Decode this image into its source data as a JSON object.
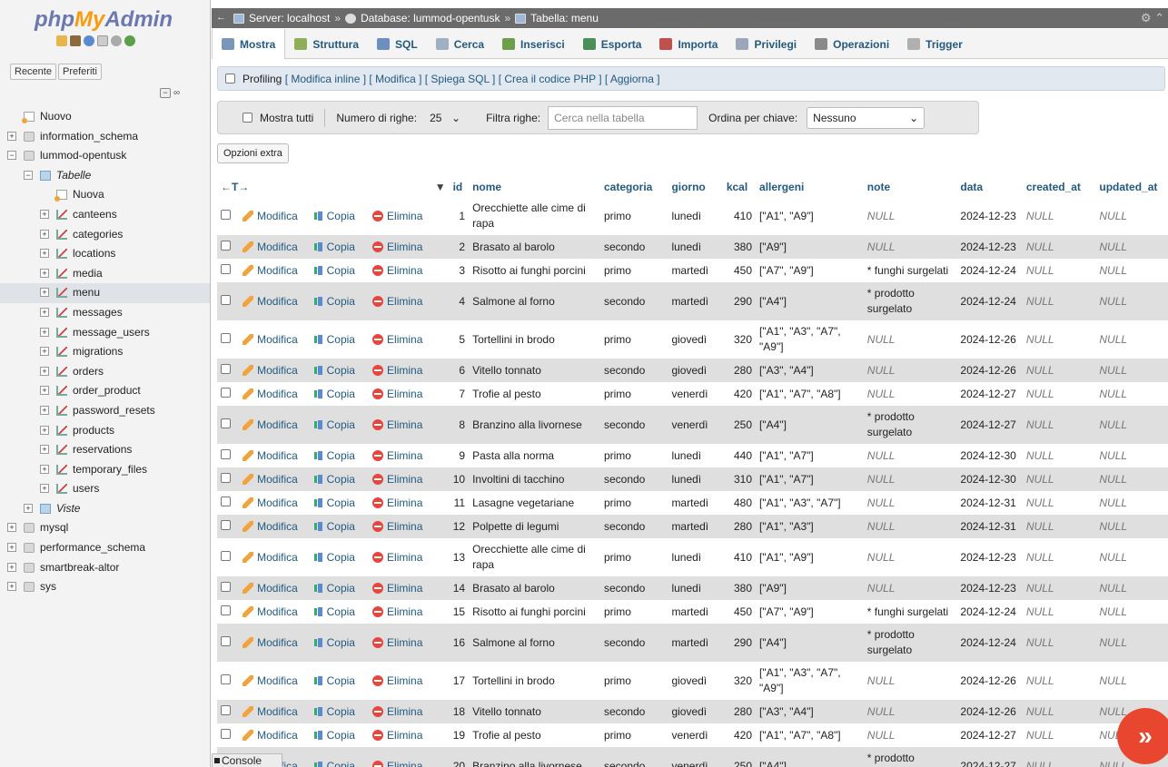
{
  "sidebar": {
    "logo_php": "php",
    "logo_my": "My",
    "logo_admin": "Admin",
    "recent": "Recente",
    "favorites": "Preferiti",
    "tree": [
      {
        "label": "Nuovo",
        "indent": 0,
        "icon": "new-icon",
        "exp": ""
      },
      {
        "label": "information_schema",
        "indent": 0,
        "icon": "database-icon",
        "exp": "+"
      },
      {
        "label": "lummod-opentusk",
        "indent": 0,
        "icon": "database-icon",
        "exp": "−"
      },
      {
        "label": "Tabelle",
        "indent": 1,
        "icon": "folder-icon",
        "exp": "−",
        "italic": true
      },
      {
        "label": "Nuova",
        "indent": 2,
        "icon": "new-icon",
        "exp": ""
      },
      {
        "label": "canteens",
        "indent": 2,
        "icon": "table-icon",
        "exp": "+"
      },
      {
        "label": "categories",
        "indent": 2,
        "icon": "table-icon",
        "exp": "+"
      },
      {
        "label": "locations",
        "indent": 2,
        "icon": "table-icon",
        "exp": "+"
      },
      {
        "label": "media",
        "indent": 2,
        "icon": "table-icon",
        "exp": "+"
      },
      {
        "label": "menu",
        "indent": 2,
        "icon": "table-icon",
        "exp": "+",
        "selected": true
      },
      {
        "label": "messages",
        "indent": 2,
        "icon": "table-icon",
        "exp": "+"
      },
      {
        "label": "message_users",
        "indent": 2,
        "icon": "table-icon",
        "exp": "+"
      },
      {
        "label": "migrations",
        "indent": 2,
        "icon": "table-icon",
        "exp": "+"
      },
      {
        "label": "orders",
        "indent": 2,
        "icon": "table-icon",
        "exp": "+"
      },
      {
        "label": "order_product",
        "indent": 2,
        "icon": "table-icon",
        "exp": "+"
      },
      {
        "label": "password_resets",
        "indent": 2,
        "icon": "table-icon",
        "exp": "+"
      },
      {
        "label": "products",
        "indent": 2,
        "icon": "table-icon",
        "exp": "+"
      },
      {
        "label": "reservations",
        "indent": 2,
        "icon": "table-icon",
        "exp": "+"
      },
      {
        "label": "temporary_files",
        "indent": 2,
        "icon": "table-icon",
        "exp": "+"
      },
      {
        "label": "users",
        "indent": 2,
        "icon": "table-icon",
        "exp": "+"
      },
      {
        "label": "Viste",
        "indent": 1,
        "icon": "folder-icon",
        "exp": "+",
        "italic": true
      },
      {
        "label": "mysql",
        "indent": 0,
        "icon": "database-icon",
        "exp": "+"
      },
      {
        "label": "performance_schema",
        "indent": 0,
        "icon": "database-icon",
        "exp": "+"
      },
      {
        "label": "smartbreak-altor",
        "indent": 0,
        "icon": "database-icon",
        "exp": "+"
      },
      {
        "label": "sys",
        "indent": 0,
        "icon": "database-icon",
        "exp": "+"
      }
    ]
  },
  "breadcrumb": {
    "server": "Server: localhost",
    "database": "Database: lummod-opentusk",
    "table": "Tabella: menu",
    "sep": "»"
  },
  "tabs": [
    {
      "label": "Mostra",
      "color": "#7a96b8"
    },
    {
      "label": "Struttura",
      "color": "#8fae5a"
    },
    {
      "label": "SQL",
      "color": "#6c8fbf"
    },
    {
      "label": "Cerca",
      "color": "#9fb0c0"
    },
    {
      "label": "Inserisci",
      "color": "#6d9f4a"
    },
    {
      "label": "Esporta",
      "color": "#4a8f5a"
    },
    {
      "label": "Importa",
      "color": "#c0504d"
    },
    {
      "label": "Privilegi",
      "color": "#9aa7b8"
    },
    {
      "label": "Operazioni",
      "color": "#8a8a8a"
    },
    {
      "label": "Trigger",
      "color": "#b0b0b0"
    }
  ],
  "profiling": {
    "label": "Profiling",
    "links": "[ Modifica inline ] [ Modifica ] [ Spiega SQL ] [ Crea il codice PHP ] [ Aggiorna ]"
  },
  "nav": {
    "show_all": "Mostra tutti",
    "rows_label": "Numero di righe:",
    "rows_value": "25",
    "filter_label": "Filtra righe:",
    "filter_placeholder": "Cerca nella tabella",
    "order_label": "Ordina per chiave:",
    "order_value": "Nessuno"
  },
  "extra_options": "Opzioni extra",
  "table": {
    "arrows": "←T→",
    "sort_arrow": "▼",
    "columns": [
      "id",
      "nome",
      "categoria",
      "giorno",
      "kcal",
      "allergeni",
      "note",
      "data",
      "created_at",
      "updated_at"
    ],
    "action_labels": {
      "edit": "Modifica",
      "copy": "Copia",
      "delete": "Elimina"
    },
    "rows": [
      [
        "1",
        "Orecchiette alle cime di rapa",
        "primo",
        "lunedì",
        "410",
        "[\"A1\", \"A9\"]",
        "NULL",
        "2024-12-23",
        "NULL",
        "NULL"
      ],
      [
        "2",
        "Brasato al barolo",
        "secondo",
        "lunedì",
        "380",
        "[\"A9\"]",
        "NULL",
        "2024-12-23",
        "NULL",
        "NULL"
      ],
      [
        "3",
        "Risotto ai funghi porcini",
        "primo",
        "martedì",
        "450",
        "[\"A7\", \"A9\"]",
        "* funghi surgelati",
        "2024-12-24",
        "NULL",
        "NULL"
      ],
      [
        "4",
        "Salmone al forno",
        "secondo",
        "martedì",
        "290",
        "[\"A4\"]",
        "* prodotto surgelato",
        "2024-12-24",
        "NULL",
        "NULL"
      ],
      [
        "5",
        "Tortellini in brodo",
        "primo",
        "giovedì",
        "320",
        "[\"A1\", \"A3\", \"A7\", \"A9\"]",
        "NULL",
        "2024-12-26",
        "NULL",
        "NULL"
      ],
      [
        "6",
        "Vitello tonnato",
        "secondo",
        "giovedì",
        "280",
        "[\"A3\", \"A4\"]",
        "NULL",
        "2024-12-26",
        "NULL",
        "NULL"
      ],
      [
        "7",
        "Trofie al pesto",
        "primo",
        "venerdì",
        "420",
        "[\"A1\", \"A7\", \"A8\"]",
        "NULL",
        "2024-12-27",
        "NULL",
        "NULL"
      ],
      [
        "8",
        "Branzino alla livornese",
        "secondo",
        "venerdì",
        "250",
        "[\"A4\"]",
        "* prodotto surgelato",
        "2024-12-27",
        "NULL",
        "NULL"
      ],
      [
        "9",
        "Pasta alla norma",
        "primo",
        "lunedì",
        "440",
        "[\"A1\", \"A7\"]",
        "NULL",
        "2024-12-30",
        "NULL",
        "NULL"
      ],
      [
        "10",
        "Involtini di tacchino",
        "secondo",
        "lunedì",
        "310",
        "[\"A1\", \"A7\"]",
        "NULL",
        "2024-12-30",
        "NULL",
        "NULL"
      ],
      [
        "11",
        "Lasagne vegetariane",
        "primo",
        "martedì",
        "480",
        "[\"A1\", \"A3\", \"A7\"]",
        "NULL",
        "2024-12-31",
        "NULL",
        "NULL"
      ],
      [
        "12",
        "Polpette di legumi",
        "secondo",
        "martedì",
        "280",
        "[\"A1\", \"A3\"]",
        "NULL",
        "2024-12-31",
        "NULL",
        "NULL"
      ],
      [
        "13",
        "Orecchiette alle cime di rapa",
        "primo",
        "lunedì",
        "410",
        "[\"A1\", \"A9\"]",
        "NULL",
        "2024-12-23",
        "NULL",
        "NULL"
      ],
      [
        "14",
        "Brasato al barolo",
        "secondo",
        "lunedì",
        "380",
        "[\"A9\"]",
        "NULL",
        "2024-12-23",
        "NULL",
        "NULL"
      ],
      [
        "15",
        "Risotto ai funghi porcini",
        "primo",
        "martedì",
        "450",
        "[\"A7\", \"A9\"]",
        "* funghi surgelati",
        "2024-12-24",
        "NULL",
        "NULL"
      ],
      [
        "16",
        "Salmone al forno",
        "secondo",
        "martedì",
        "290",
        "[\"A4\"]",
        "* prodotto surgelato",
        "2024-12-24",
        "NULL",
        "NULL"
      ],
      [
        "17",
        "Tortellini in brodo",
        "primo",
        "giovedì",
        "320",
        "[\"A1\", \"A3\", \"A7\", \"A9\"]",
        "NULL",
        "2024-12-26",
        "NULL",
        "NULL"
      ],
      [
        "18",
        "Vitello tonnato",
        "secondo",
        "giovedì",
        "280",
        "[\"A3\", \"A4\"]",
        "NULL",
        "2024-12-26",
        "NULL",
        "NULL"
      ],
      [
        "19",
        "Trofie al pesto",
        "primo",
        "venerdì",
        "420",
        "[\"A1\", \"A7\", \"A8\"]",
        "NULL",
        "2024-12-27",
        "NULL",
        "NULL"
      ],
      [
        "20",
        "Branzino alla livornese",
        "secondo",
        "venerdì",
        "250",
        "[\"A4\"]",
        "* prodotto surgelato",
        "2024-12-27",
        "NULL",
        "NULL"
      ]
    ]
  },
  "console": "Console",
  "colors": {
    "accent": "#235a81",
    "topbar": "#6b6b6b",
    "row_alt": "#dfdfdf",
    "fab": "#e8462e"
  }
}
